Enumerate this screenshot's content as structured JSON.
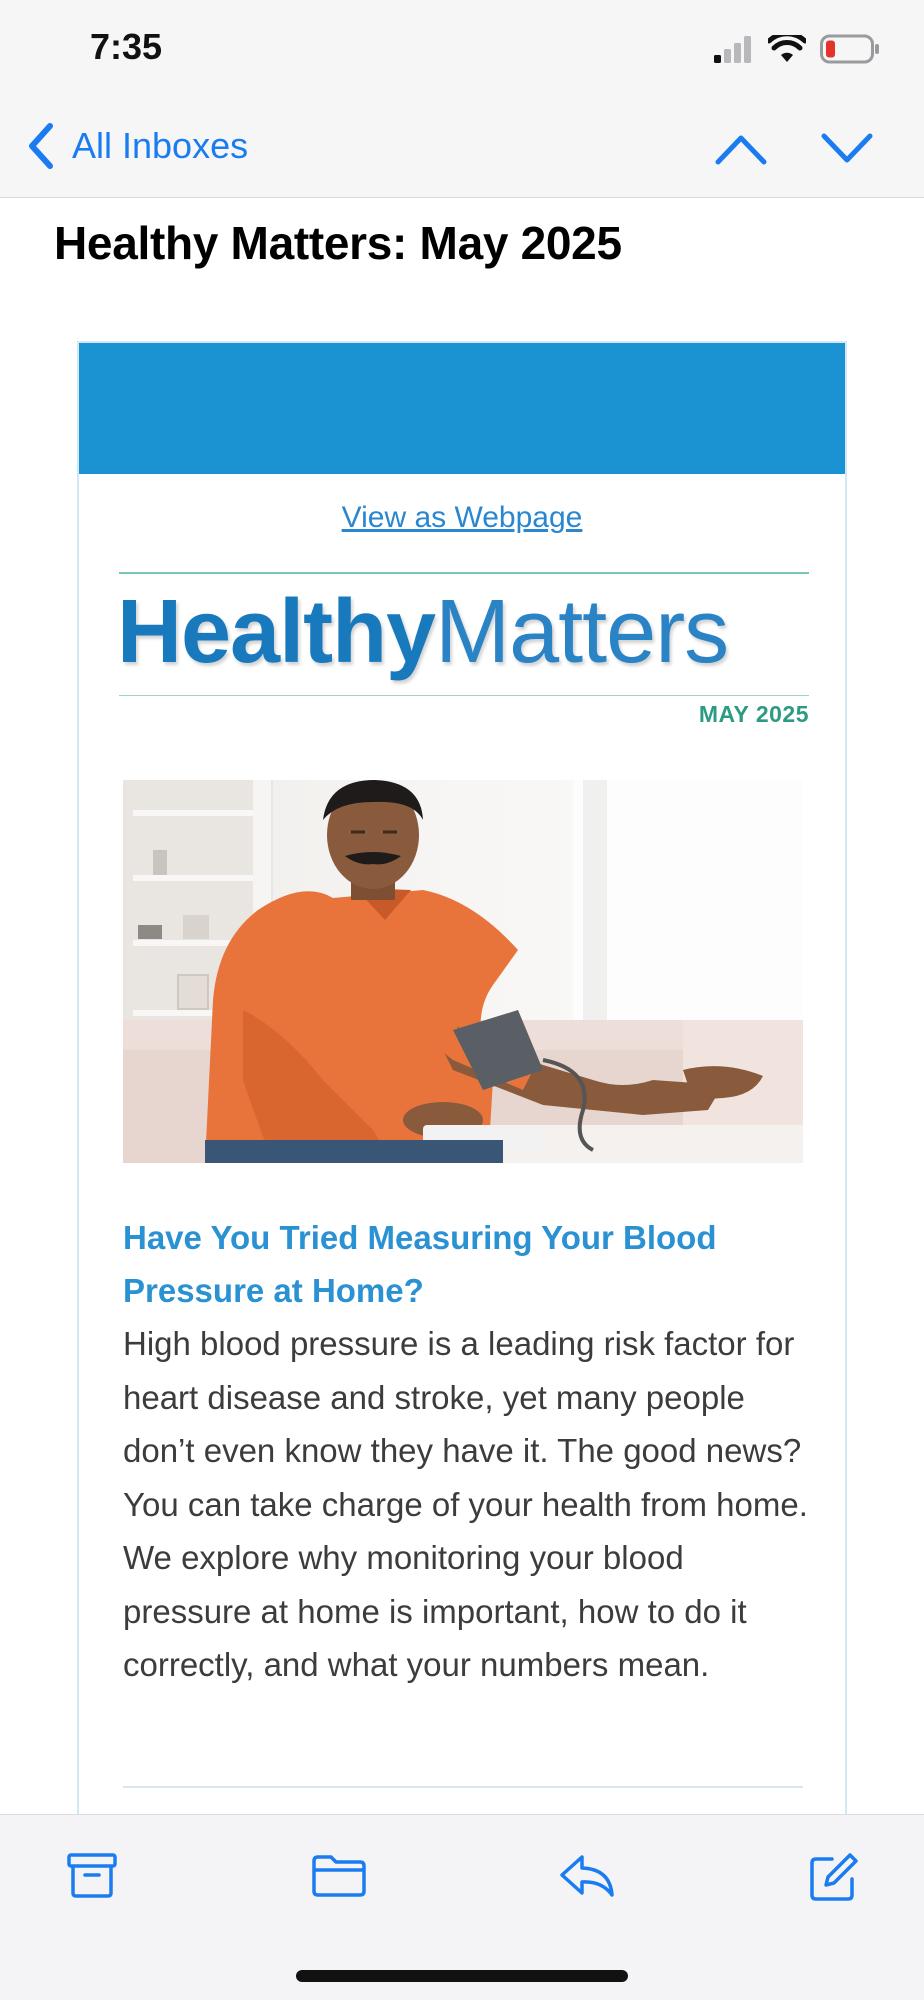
{
  "status_bar": {
    "time": "7:35"
  },
  "nav": {
    "back_label": "All Inboxes"
  },
  "email": {
    "subject": "Healthy Matters: May 2025",
    "view_webpage_label": "View as Webpage",
    "logo": {
      "bold_part": "Healthy",
      "light_part": "Matters"
    },
    "issue_date": "MAY 2025",
    "hero_image_alt": "man-measuring-blood-pressure",
    "article": {
      "title": "Have You Tried Measuring Your Blood Pressure at Home?",
      "body": "High blood pressure is a leading risk factor for heart disease and stroke, yet many people don’t even know they have it. The good news? You can take charge of your health from home. We explore why monitoring your blood pressure at home is important, how to do it correctly, and what your numbers mean."
    }
  },
  "colors": {
    "ios_blue": "#1a7cf0",
    "banner_blue": "#1b93d3",
    "title_blue": "#2a91d2",
    "date_green": "#2d9b84",
    "battery_low_red": "#e5322d"
  },
  "toolbar": {
    "icons": [
      "archive-icon",
      "folder-icon",
      "reply-icon",
      "compose-icon"
    ]
  }
}
